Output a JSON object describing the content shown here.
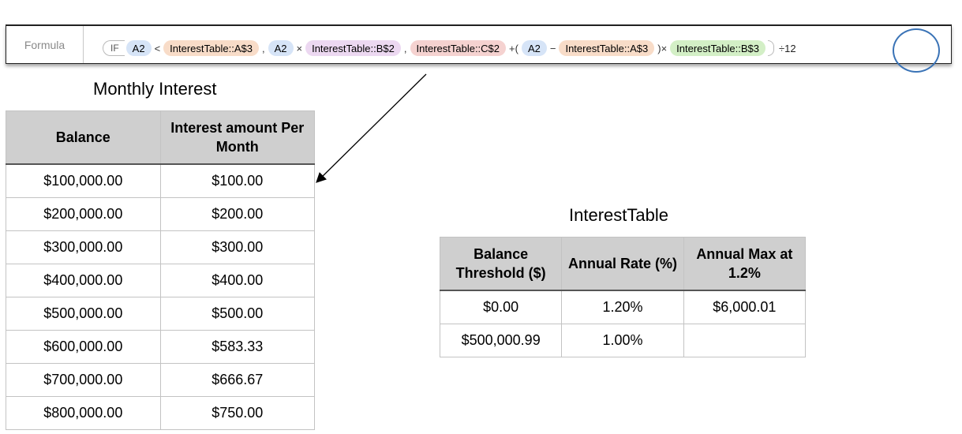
{
  "formula_bar": {
    "label": "Formula",
    "function": "IF",
    "tokens": {
      "t1": "A2",
      "op1": "<",
      "t2": "InterestTable::A$3",
      "sep1": ",",
      "t3": "A2",
      "op2": "×",
      "t4": "InterestTable::B$2",
      "sep2": ",",
      "t5": "InterestTable::C$2",
      "op3": "+(",
      "t6": "A2",
      "op4": "−",
      "t7": "InterestTable::A$3",
      "op5": ")×",
      "t8": "InterestTable::B$3",
      "tail": "÷12"
    },
    "colors": {
      "highlight_circle": "#3a73b6"
    }
  },
  "monthly_interest": {
    "title": "Monthly Interest",
    "headers": [
      "Balance",
      "Interest amount Per Month"
    ],
    "rows": [
      [
        "$100,000.00",
        "$100.00"
      ],
      [
        "$200,000.00",
        "$200.00"
      ],
      [
        "$300,000.00",
        "$300.00"
      ],
      [
        "$400,000.00",
        "$400.00"
      ],
      [
        "$500,000.00",
        "$500.00"
      ],
      [
        "$600,000.00",
        "$583.33"
      ],
      [
        "$700,000.00",
        "$666.67"
      ],
      [
        "$800,000.00",
        "$750.00"
      ]
    ]
  },
  "interest_table": {
    "title": "InterestTable",
    "headers": [
      "Balance Threshold ($)",
      "Annual Rate (%)",
      "Annual Max at 1.2%"
    ],
    "rows": [
      [
        "$0.00",
        "1.20%",
        "$6,000.01"
      ],
      [
        "$500,000.99",
        "1.00%",
        ""
      ]
    ]
  }
}
